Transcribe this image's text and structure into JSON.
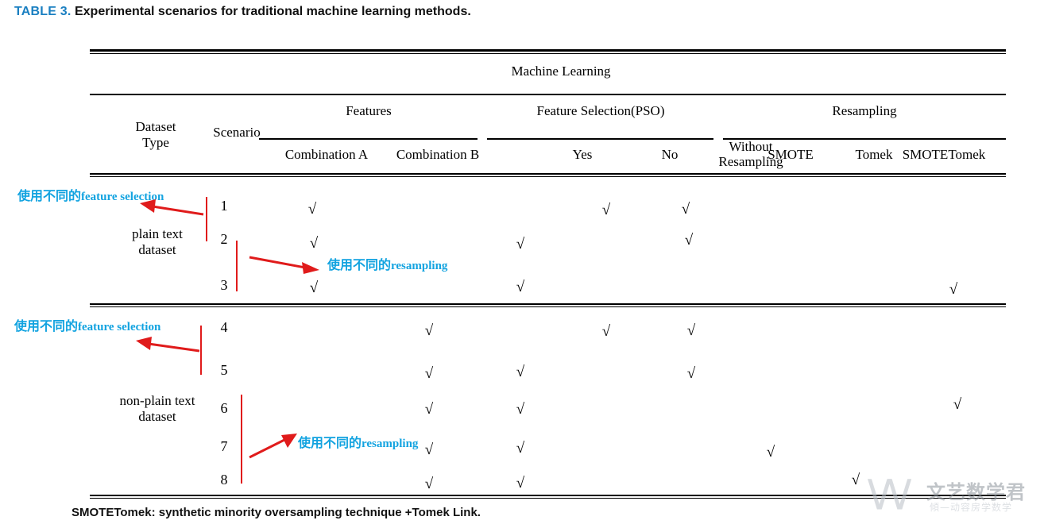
{
  "caption": {
    "table_number": "TABLE 3.",
    "text": "Experimental scenarios for traditional machine learning methods.",
    "accent_color": "#1a7fc1"
  },
  "table": {
    "super_group": "Machine Learning",
    "groups": [
      {
        "label": "Features"
      },
      {
        "label": "Feature Selection(PSO)"
      },
      {
        "label": "Resampling"
      }
    ],
    "stub_headers": {
      "dataset_type_line1": "Dataset",
      "dataset_type_line2": "Type",
      "scenario": "Scenario"
    },
    "columns": [
      "Combination A",
      "Combination B",
      "Yes",
      "No",
      "Without Resampling",
      "SMOTE",
      "Tomek",
      "SMOTETomek"
    ],
    "column_without_resampling_line1": "Without",
    "column_without_resampling_line2": "Resampling",
    "dataset_types": [
      {
        "line1": "plain text",
        "line2": "dataset"
      },
      {
        "line1": "non-plain text",
        "line2": "dataset"
      }
    ],
    "check_glyph": "√",
    "rows": [
      {
        "scenario": "1",
        "marks": [
          true,
          false,
          false,
          true,
          true,
          false,
          false,
          false
        ]
      },
      {
        "scenario": "2",
        "marks": [
          true,
          false,
          true,
          false,
          true,
          false,
          false,
          false
        ]
      },
      {
        "scenario": "3",
        "marks": [
          true,
          false,
          true,
          false,
          false,
          false,
          false,
          true
        ]
      },
      {
        "scenario": "4",
        "marks": [
          false,
          true,
          false,
          true,
          true,
          false,
          false,
          false
        ]
      },
      {
        "scenario": "5",
        "marks": [
          false,
          true,
          true,
          false,
          true,
          false,
          false,
          false
        ]
      },
      {
        "scenario": "6",
        "marks": [
          false,
          true,
          true,
          false,
          false,
          false,
          false,
          true
        ]
      },
      {
        "scenario": "7",
        "marks": [
          false,
          true,
          true,
          false,
          false,
          true,
          false,
          false
        ]
      },
      {
        "scenario": "8",
        "marks": [
          false,
          true,
          true,
          false,
          false,
          false,
          true,
          false
        ]
      }
    ]
  },
  "annotations": {
    "color": "#12a3e0",
    "bracket_color": "#e01b1b",
    "items": [
      {
        "cjk": "使用不同的",
        "latin": "feature selection"
      },
      {
        "cjk": "使用不同的",
        "latin": "resampling"
      },
      {
        "cjk": "使用不同的",
        "latin": "feature selection"
      },
      {
        "cjk": "使用不同的",
        "latin": "resampling"
      }
    ]
  },
  "footnote": "SMOTETomek: synthetic minority oversampling technique +Tomek Link.",
  "watermark": {
    "mark": "\\/\\/",
    "title": "文艺数学君",
    "subtitle": "傾—动容房学数学"
  }
}
